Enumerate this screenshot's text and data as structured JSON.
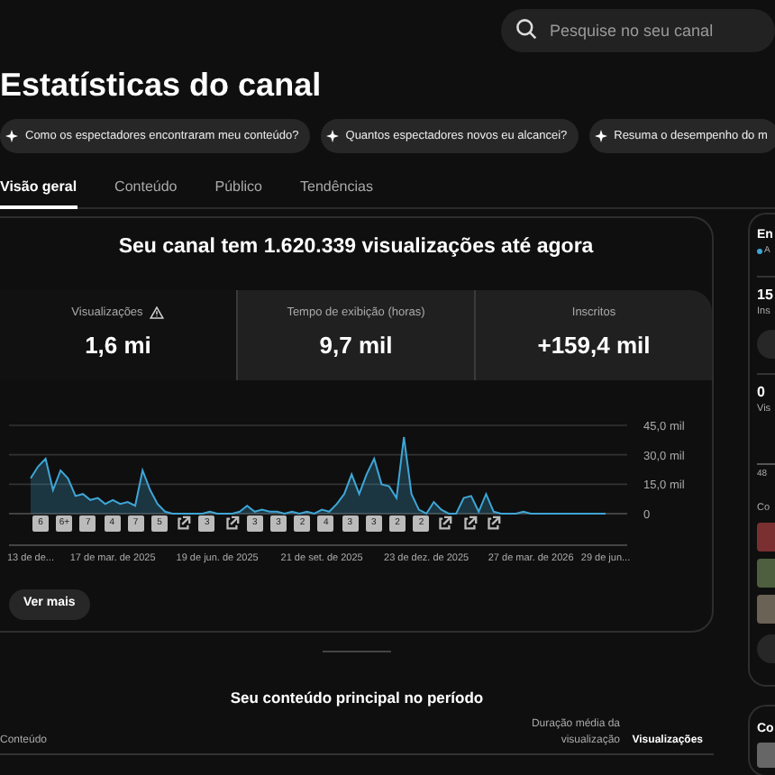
{
  "search": {
    "placeholder": "Pesquise no seu canal"
  },
  "title": "Estatísticas do canal",
  "suggestions": [
    "Como os espectadores encontraram meu conteúdo?",
    "Quantos espectadores novos eu alcancei?",
    "Resuma o desempenho do m"
  ],
  "tabs": [
    {
      "label": "Visão geral",
      "selected": true
    },
    {
      "label": "Conteúdo",
      "selected": false
    },
    {
      "label": "Público",
      "selected": false
    },
    {
      "label": "Tendências",
      "selected": false
    }
  ],
  "headline": "Seu canal tem 1.620.339 visualizações até agora",
  "metrics": [
    {
      "label": "Visualizações",
      "value": "1,6 mi",
      "selected": true,
      "warning": true
    },
    {
      "label": "Tempo de exibição (horas)",
      "value": "9,7 mil",
      "selected": false,
      "warning": false
    },
    {
      "label": "Inscritos",
      "value": "+159,4 mil",
      "selected": false,
      "warning": false
    }
  ],
  "chart_data": {
    "type": "line",
    "ylim": [
      0,
      45
    ],
    "yticks": [
      {
        "value": 0,
        "label": "0"
      },
      {
        "value": 15,
        "label": "15,0 mil"
      },
      {
        "value": 30,
        "label": "30,0 mil"
      },
      {
        "value": 45,
        "label": "45,0 mil"
      }
    ],
    "categories": [
      "13 de de...",
      null,
      null,
      null,
      null,
      null,
      null,
      null,
      null,
      null,
      null,
      "17 de mar. de 2025",
      null,
      null,
      null,
      null,
      null,
      null,
      null,
      null,
      null,
      null,
      null,
      null,
      null,
      "19 de jun. de 2025",
      null,
      null,
      null,
      null,
      null,
      null,
      null,
      null,
      null,
      null,
      null,
      null,
      null,
      "21 de set. de 2025",
      null,
      null,
      null,
      null,
      null,
      null,
      null,
      null,
      null,
      null,
      null,
      null,
      null,
      "23 de dez. de 2025",
      null,
      null,
      null,
      null,
      null,
      null,
      null,
      null,
      null,
      null,
      null,
      null,
      null,
      "27 de mar. de 2026",
      null,
      null,
      null,
      null,
      null,
      null,
      null,
      null,
      null,
      "29 de jun..."
    ],
    "series": [
      {
        "color": "#3ea6d6",
        "values": [
          18,
          24,
          28,
          12,
          22,
          18,
          9,
          10,
          7,
          8,
          5,
          7,
          5,
          6,
          4,
          22,
          12,
          5,
          1,
          0,
          0,
          0,
          0,
          0,
          1,
          0,
          0,
          0,
          1,
          4,
          1,
          2,
          1,
          1,
          0,
          1,
          0,
          1,
          0,
          2,
          1,
          5,
          10,
          20,
          10,
          20,
          28,
          15,
          14,
          8,
          39,
          10,
          2,
          0,
          6,
          2,
          0,
          0,
          8,
          9,
          1,
          10,
          1,
          0,
          0,
          0,
          1,
          0,
          0,
          0,
          0,
          0,
          0,
          0,
          0,
          0,
          0,
          0
        ]
      }
    ]
  },
  "markers": [
    {
      "kind": "count",
      "label": "6"
    },
    {
      "kind": "count",
      "label": "6+"
    },
    {
      "kind": "count",
      "label": "7"
    },
    {
      "kind": "count",
      "label": "4"
    },
    {
      "kind": "count",
      "label": "7"
    },
    {
      "kind": "count",
      "label": "5"
    },
    {
      "kind": "link"
    },
    {
      "kind": "count",
      "label": "3"
    },
    {
      "kind": "link"
    },
    {
      "kind": "count",
      "label": "3"
    },
    {
      "kind": "count",
      "label": "3"
    },
    {
      "kind": "count",
      "label": "2"
    },
    {
      "kind": "count",
      "label": "4"
    },
    {
      "kind": "count",
      "label": "3"
    },
    {
      "kind": "count",
      "label": "3"
    },
    {
      "kind": "count",
      "label": "2"
    },
    {
      "kind": "count",
      "label": "2"
    },
    {
      "kind": "link"
    },
    {
      "kind": "link"
    },
    {
      "kind": "link"
    }
  ],
  "more_button": "Ver mais",
  "top_content": {
    "title": "Seu conteúdo principal no período",
    "columns": [
      "Conteúdo",
      "Duração média da visualização",
      "Visualizações"
    ]
  },
  "side_panel": {
    "title": "En",
    "legend": "A",
    "stat_1": {
      "value": "15",
      "label": "Ins"
    },
    "stat_2": {
      "value": "0",
      "label": "Vis"
    },
    "axis_label": "48",
    "section_label": "Co",
    "thumbnails": [
      {
        "color": "#7a3030"
      },
      {
        "color": "#4d5f3f"
      },
      {
        "color": "#6a6255"
      }
    ]
  },
  "side_panel_2": {
    "title": "Co"
  }
}
